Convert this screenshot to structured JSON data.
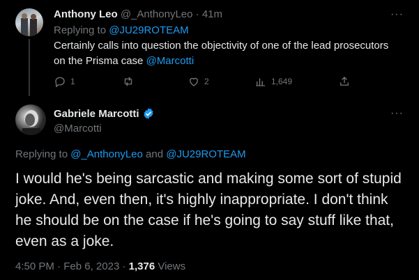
{
  "reply": {
    "name": "Anthony Leo",
    "handle": "@_AnthonyLeo",
    "time": "41m",
    "replying_prefix": "Replying to",
    "replying_to": "@JU29ROTEAM",
    "text_main": "Certainly calls into question the objectivity of one of the lead prosecutors on the Prisma case",
    "text_mention": "@Marcotti",
    "replies_count": "1",
    "retweets_count": "",
    "likes_count": "2",
    "views_count": "1,649"
  },
  "main": {
    "name": "Gabriele Marcotti",
    "handle": "@Marcotti",
    "replying_prefix": "Replying to",
    "replying_user1": "@_AnthonyLeo",
    "replying_and": "and",
    "replying_user2": "@JU29ROTEAM",
    "text": "I would he's being sarcastic and making some sort of stupid joke. And, even then, it's highly inappropriate. I don't think he should be on the case if he's going to say stuff like that, even as a joke.",
    "time": "4:50 PM",
    "date": "Feb 6, 2023",
    "views_count": "1,376",
    "views_label": "Views"
  },
  "more_glyph": "···",
  "colors": {
    "background": "#000000",
    "text": "#e7e9ea",
    "muted": "#71767b",
    "link": "#1d9bf0",
    "divider": "#333639"
  }
}
